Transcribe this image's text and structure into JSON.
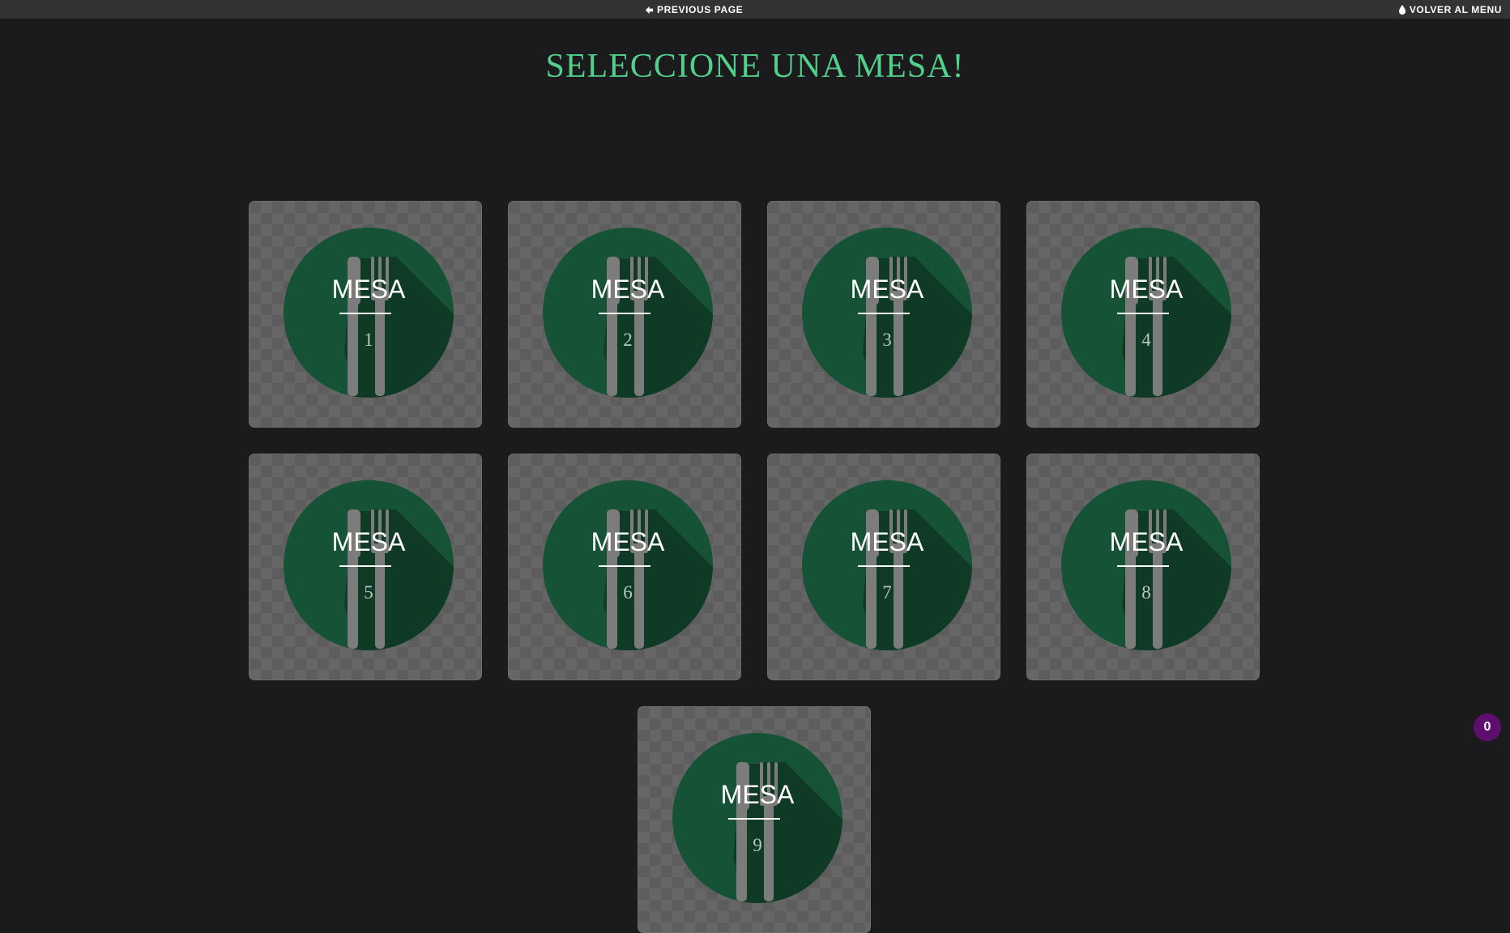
{
  "topbar": {
    "previous_label": "PREVIOUS PAGE",
    "menu_label": "VOLVER AL MENU"
  },
  "page_title": "SELECCIONE UNA MESA!",
  "tables": [
    {
      "label": "MESA",
      "number": "1"
    },
    {
      "label": "MESA",
      "number": "2"
    },
    {
      "label": "MESA",
      "number": "3"
    },
    {
      "label": "MESA",
      "number": "4"
    },
    {
      "label": "MESA",
      "number": "5"
    },
    {
      "label": "MESA",
      "number": "6"
    },
    {
      "label": "MESA",
      "number": "7"
    },
    {
      "label": "MESA",
      "number": "8"
    },
    {
      "label": "MESA",
      "number": "9"
    }
  ],
  "badge_count": "0",
  "icons": {
    "previous": "arrow-left-icon",
    "menu": "droplet-icon",
    "table": "fork-knife-icon"
  },
  "colors": {
    "title": "#52cf8a",
    "emblem": "#165236",
    "emblem_shadow": "#0f3a26",
    "badge": "#5e0f6e"
  }
}
